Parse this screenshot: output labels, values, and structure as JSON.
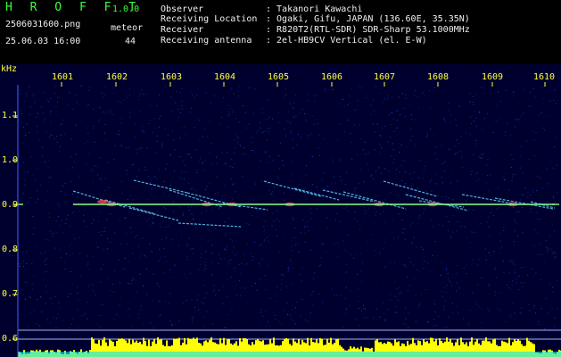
{
  "app": {
    "name": "H R O F F T",
    "version": "1.0.0"
  },
  "file": {
    "name": "2506031600.png",
    "datetime": "25.06.03 16:00"
  },
  "detection": {
    "label": "meteor",
    "count": "44"
  },
  "info": [
    {
      "key": "Observer",
      "value": ": Takanori Kawachi"
    },
    {
      "key": "Receiving Location",
      "value": ": Ogaki, Gifu, JAPAN (136.60E, 35.35N)"
    },
    {
      "key": "Receiver",
      "value": ": R820T2(RTL-SDR) SDR-Sharp 53.1000MHz"
    },
    {
      "key": "Receiving antenna",
      "value": ": 2el-HB9CV Vertical (el. E-W)"
    }
  ],
  "axis": {
    "unit": "kHz",
    "x_ticks": [
      "1601",
      "1602",
      "1603",
      "1604",
      "1605",
      "1606",
      "1607",
      "1608",
      "1609",
      "1610"
    ],
    "y_ticks": [
      "1.1",
      "1.0",
      "0.9",
      "0.8",
      "0.7",
      "0.6"
    ]
  },
  "colors": {
    "background": "#00002e",
    "carrier": "#8cff8c",
    "meteor_trail": "#5ad0ff",
    "meteor_head": "#ff5050",
    "level_bar": "#ffff00",
    "level_base": "#00e5ff"
  }
}
